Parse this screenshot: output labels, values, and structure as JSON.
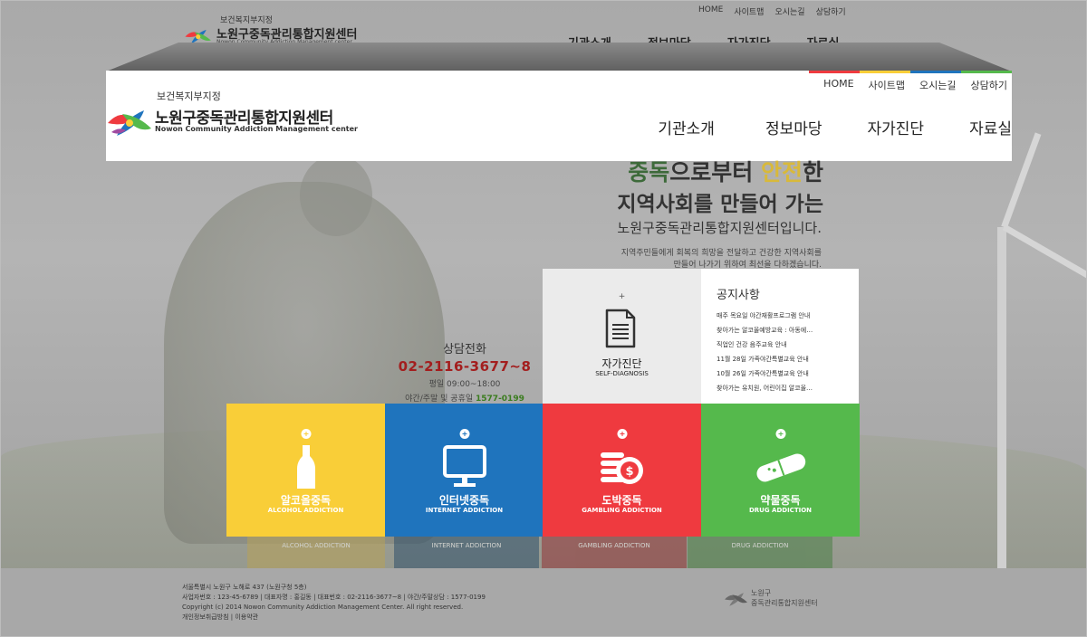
{
  "colors": {
    "alcohol": "#f9ce38",
    "internet": "#1f74bd",
    "gambling": "#ef3a3f",
    "drug": "#55b94c",
    "strip": [
      "#ef3a3f",
      "#f9ce38",
      "#1f74bd",
      "#55b94c"
    ]
  },
  "underlay": {
    "util": [
      "HOME",
      "사이트맵",
      "오시는길",
      "상담하기"
    ],
    "gov": "보건복지부지정",
    "name_kr": "노원구중독관리통합지원센터",
    "name_en": "Nowon Community Addiction Management center",
    "nav": [
      "기관소개",
      "정보마당",
      "자가진단",
      "자료실"
    ]
  },
  "header": {
    "util": [
      "HOME",
      "사이트맵",
      "오시는길",
      "상담하기"
    ],
    "gov": "보건복지부지정",
    "name_kr": "노원구중독관리통합지원센터",
    "name_en": "Nowon Community Addiction Management center",
    "nav": [
      "기관소개",
      "정보마당",
      "자가진단",
      "자료실"
    ]
  },
  "hero": {
    "line1_a": "중독",
    "line1_b": "으로부터 ",
    "line1_c": "안전",
    "line1_d": "한",
    "line2": "지역사회를 만들어 가는",
    "line3": "노원구중독관리통합지원센터입니다.",
    "line4a": "지역주민들에게 회복의 희망을 전달하고 건강한 지역사회를",
    "line4b": "만들어 나가기 위하여 최선을 다하겠습니다."
  },
  "counsel": {
    "title": "상담전화",
    "phone": "02-2116-3677~8",
    "hours": "평일 09:00~18:00",
    "night_label": "야간/주말 및 공휴일",
    "night_phone": "1577-0199"
  },
  "self": {
    "plus": "+",
    "kr": "자가진단",
    "en": "SELF-DIAGNOSIS"
  },
  "notice": {
    "title": "공지사항",
    "items": [
      "매주 목요일 야간재활프로그램 안내",
      "찾아가는 알코올예방교육 : 아동에…",
      "직업인 건강 음주교육 안내",
      "11월 28일 가족야간특별교육 안내",
      "10월 26일 가족야간특별교육 안내",
      "찾아가는 유치원, 어린이집 알코올…"
    ]
  },
  "tiles": [
    {
      "kr": "알코올중독",
      "en": "ALCOHOL ADDICTION",
      "icon": "bottle-icon"
    },
    {
      "kr": "인터넷중독",
      "en": "INTERNET ADDICTION",
      "icon": "monitor-icon"
    },
    {
      "kr": "도박중독",
      "en": "GAMBLING ADDICTION",
      "icon": "coins-icon"
    },
    {
      "kr": "약물중독",
      "en": "DRUG ADDICTION",
      "icon": "pill-icon"
    }
  ],
  "echo": [
    "ALCOHOL ADDICTION",
    "INTERNET ADDICTION",
    "GAMBLING ADDICTION",
    "DRUG ADDICTION"
  ],
  "footer": {
    "address": "서울특별시 노원구 노해로 437 (노원구청 5층)",
    "biz": "사업자번호 : 123-45-6789    |    대표자명 : 홍길동    |    대표번호 : 02-2116-3677~8    |    야간/주말상담 : 1577-0199",
    "copyright": "Copyright (c) 2014 Nowon Community Addiction Management Center. All right reserved.",
    "privacy": "개인정보취급방침 | 이용약관",
    "logo_line1": "노원구",
    "logo_line2": "중독관리통합지원센터"
  }
}
